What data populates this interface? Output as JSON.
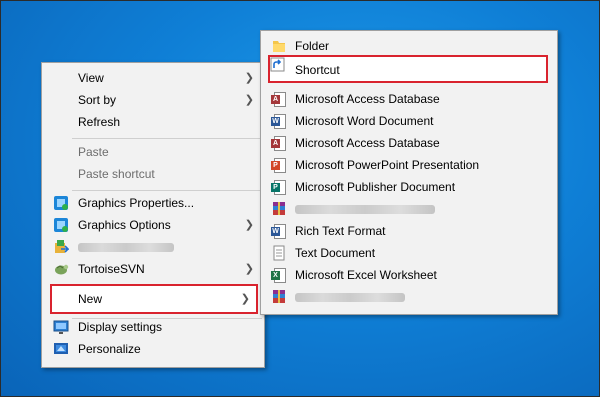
{
  "context_menu": {
    "items": [
      {
        "label": "View",
        "has_submenu": true,
        "disabled": false
      },
      {
        "label": "Sort by",
        "has_submenu": true,
        "disabled": false
      },
      {
        "label": "Refresh",
        "has_submenu": false,
        "disabled": false
      },
      {
        "label": "Paste",
        "has_submenu": false,
        "disabled": true
      },
      {
        "label": "Paste shortcut",
        "has_submenu": false,
        "disabled": true
      },
      {
        "label": "Graphics Properties...",
        "has_submenu": false,
        "disabled": false,
        "icon": "intel-graphics-icon"
      },
      {
        "label": "Graphics Options",
        "has_submenu": true,
        "disabled": false,
        "icon": "intel-graphics-icon"
      },
      {
        "label": "",
        "has_submenu": false,
        "disabled": false,
        "icon": "winrar-share-icon",
        "blurred": true
      },
      {
        "label": "TortoiseSVN",
        "has_submenu": true,
        "disabled": false,
        "icon": "tortoisesvn-icon"
      },
      {
        "label": "New",
        "has_submenu": true,
        "disabled": false,
        "highlighted": true
      },
      {
        "label": "Display settings",
        "has_submenu": false,
        "disabled": false,
        "icon": "display-icon"
      },
      {
        "label": "Personalize",
        "has_submenu": false,
        "disabled": false,
        "icon": "personalize-icon"
      }
    ]
  },
  "new_submenu": {
    "items": [
      {
        "label": "Folder",
        "icon": "folder-icon"
      },
      {
        "label": "Shortcut",
        "icon": "shortcut-icon",
        "highlighted": true
      },
      {
        "label": "Microsoft Access Database",
        "icon": "access-icon"
      },
      {
        "label": "Microsoft Word Document",
        "icon": "word-icon"
      },
      {
        "label": "Microsoft Access Database",
        "icon": "access-icon"
      },
      {
        "label": "Microsoft PowerPoint Presentation",
        "icon": "powerpoint-icon"
      },
      {
        "label": "Microsoft Publisher Document",
        "icon": "publisher-icon"
      },
      {
        "label": "",
        "icon": "winrar-archive-icon",
        "blurred": true
      },
      {
        "label": "Rich Text Format",
        "icon": "rtf-icon"
      },
      {
        "label": "Text Document",
        "icon": "text-document-icon"
      },
      {
        "label": "Microsoft Excel Worksheet",
        "icon": "excel-icon"
      },
      {
        "label": "",
        "icon": "winrar-zip-icon",
        "blurred": true
      }
    ]
  },
  "colors": {
    "highlight_border": "#d9232e",
    "desktop_blue": "#0f7fd6",
    "menu_background": "#f2f2f2"
  }
}
